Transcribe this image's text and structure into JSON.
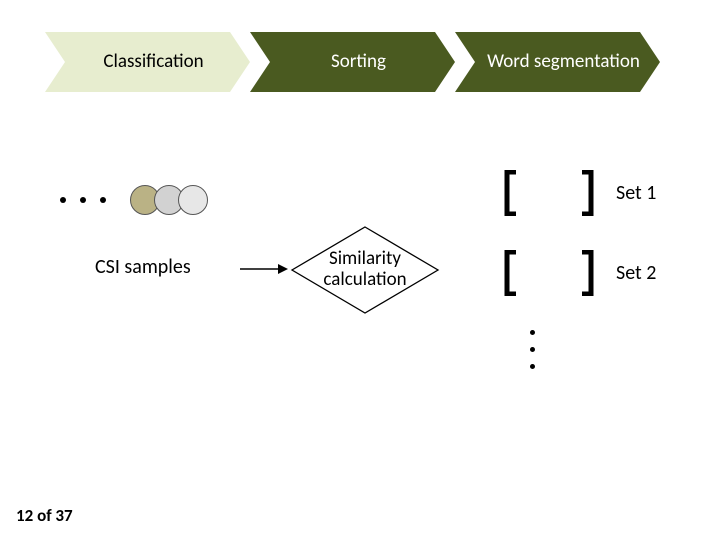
{
  "chevrons": {
    "c1": "Classification",
    "c2": "Sorting",
    "c3": "Word segmentation"
  },
  "samples_label": "CSI samples",
  "diamond_label": "Similarity calculation",
  "sets": {
    "s1": "Set 1",
    "s2": "Set 2"
  },
  "page_counter": "12 of 37",
  "colors": {
    "olive_dark": "#4a5a20",
    "olive_light": "#e7edcf"
  }
}
